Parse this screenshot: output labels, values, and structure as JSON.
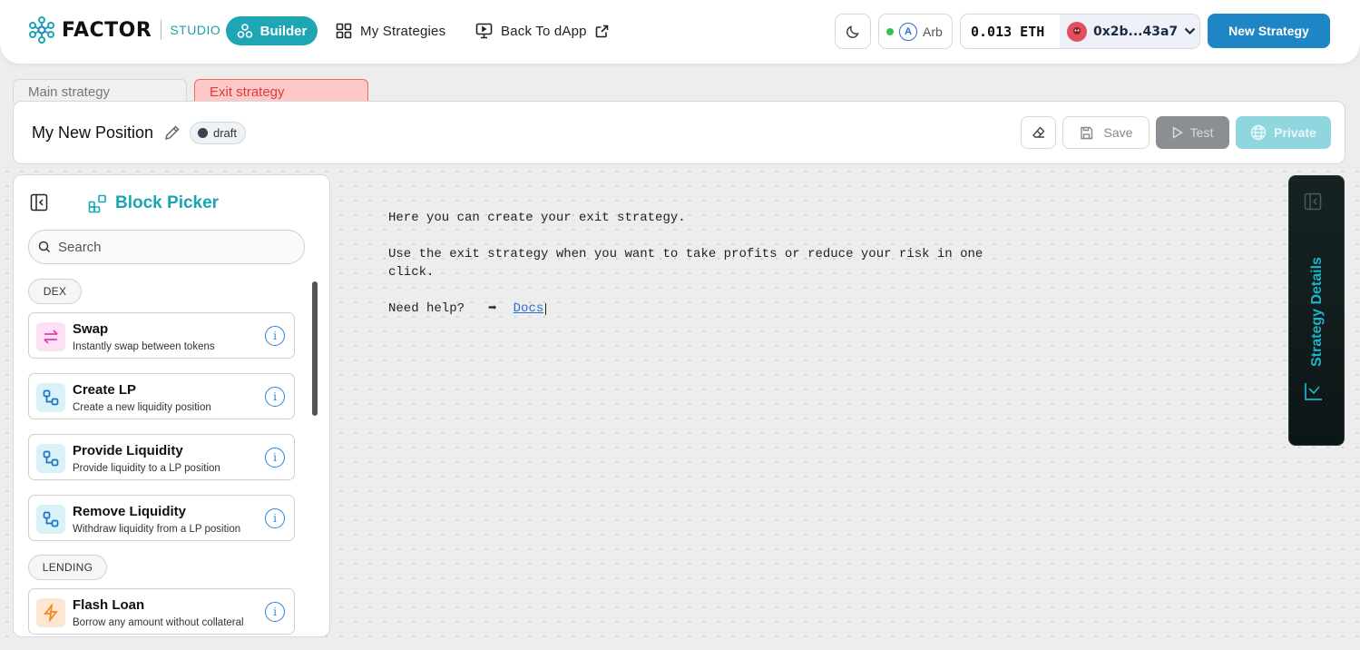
{
  "header": {
    "logo_text": "FACTOR",
    "logo_sub": "STUDIO",
    "nav": {
      "builder": "Builder",
      "my_strategies": "My Strategies",
      "back_to_dapp": "Back To dApp"
    },
    "chain": {
      "name": "Arb",
      "status_color": "#33c24d"
    },
    "wallet": {
      "balance": "0.013 ETH",
      "address": "0x2b...43a7"
    },
    "new_strategy": "New Strategy"
  },
  "tabs": [
    {
      "label": "Main strategy",
      "active": false
    },
    {
      "label": "Exit strategy",
      "active": true
    }
  ],
  "position": {
    "title": "My New Position",
    "status": "draft",
    "actions": {
      "save": "Save",
      "test": "Test",
      "private": "Private"
    }
  },
  "canvas": {
    "line1": "Here you can create your exit strategy.",
    "line2": "Use the exit strategy when you want to take profits or reduce your risk in one click.",
    "help": "Need help?",
    "arrow": "➡",
    "docs": "Docs"
  },
  "picker": {
    "title": "Block Picker",
    "search_placeholder": "Search",
    "sections": [
      {
        "tag": "DEX",
        "blocks": [
          {
            "name": "Swap",
            "desc": "Instantly swap between tokens",
            "icon": "swap-icon"
          },
          {
            "name": "Create LP",
            "desc": "Create a new liquidity position",
            "icon": "liquidity-icon"
          },
          {
            "name": "Provide Liquidity",
            "desc": "Provide liquidity to a LP position",
            "icon": "liquidity-icon"
          },
          {
            "name": "Remove Liquidity",
            "desc": "Withdraw liquidity from a LP position",
            "icon": "liquidity-icon"
          }
        ]
      },
      {
        "tag": "LENDING",
        "blocks": [
          {
            "name": "Flash Loan",
            "desc": "Borrow any amount without collateral",
            "icon": "lightning-icon"
          }
        ]
      }
    ]
  },
  "details": {
    "label": "Strategy Details"
  },
  "colors": {
    "brand": "#1fa6b5",
    "primary_button": "#1f86c5",
    "exit_tab_bg": "#fec8c8",
    "exit_tab_text": "#e23a3a",
    "details_panel": "#0d1616"
  }
}
